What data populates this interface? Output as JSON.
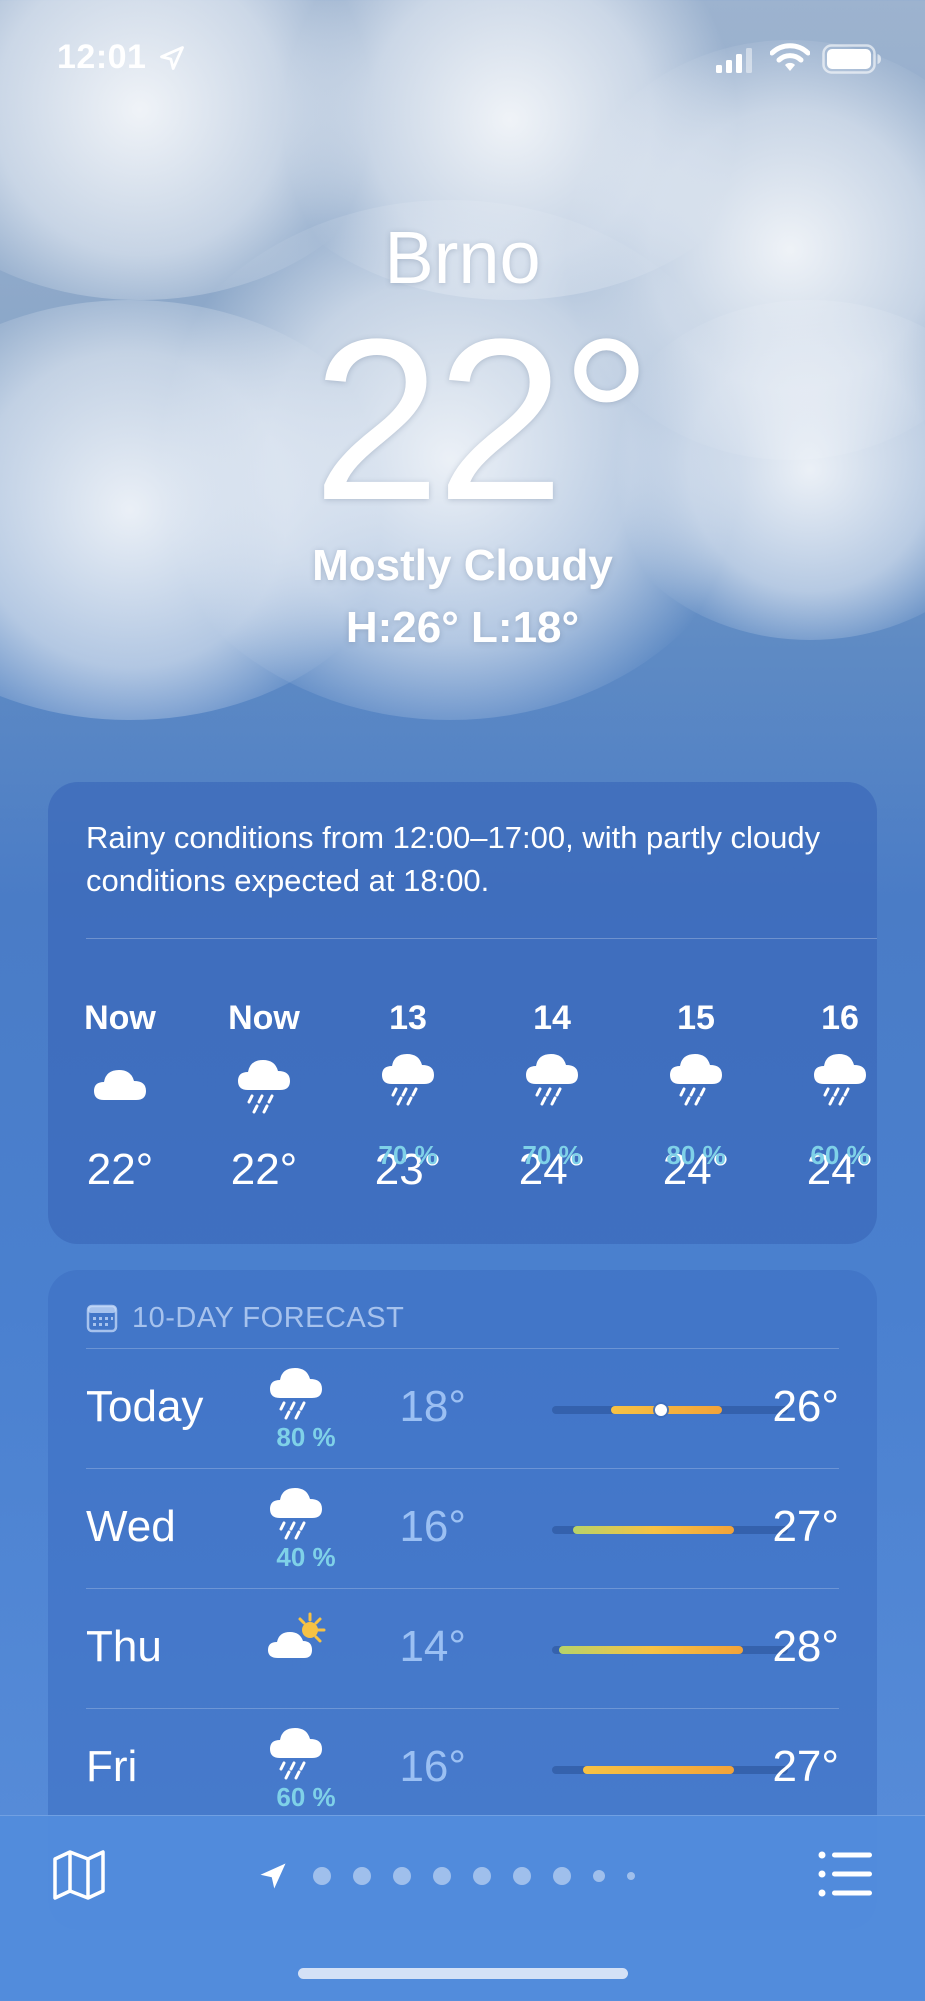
{
  "status_bar": {
    "time": "12:01"
  },
  "location": {
    "city": "Brno",
    "temperature": "22°",
    "condition": "Mostly Cloudy",
    "high_low": "H:26°  L:18°"
  },
  "hourly": {
    "summary": "Rainy conditions from 12:00–17:00, with partly cloudy conditions expected at 18:00.",
    "items": [
      {
        "label": "Now",
        "icon": "cloud-icon",
        "pop": "",
        "temp": "22°"
      },
      {
        "label": "Now",
        "icon": "cloud-rain-icon",
        "pop": "",
        "temp": "22°"
      },
      {
        "label": "13",
        "icon": "cloud-rain-icon",
        "pop": "70 %",
        "temp": "23°"
      },
      {
        "label": "14",
        "icon": "cloud-rain-icon",
        "pop": "70 %",
        "temp": "24°"
      },
      {
        "label": "15",
        "icon": "cloud-rain-icon",
        "pop": "80 %",
        "temp": "24°"
      },
      {
        "label": "16",
        "icon": "cloud-rain-icon",
        "pop": "60 %",
        "temp": "24°"
      }
    ]
  },
  "forecast": {
    "title": "10-DAY FORECAST",
    "days": [
      {
        "day": "Today",
        "icon": "cloud-rain-icon",
        "pop": "80 %",
        "low": "18°",
        "high": "26°",
        "bar_start": 0.25,
        "bar_end": 0.72,
        "current": 0.46
      },
      {
        "day": "Wed",
        "icon": "cloud-rain-icon",
        "pop": "40 %",
        "low": "16°",
        "high": "27°",
        "bar_start": 0.09,
        "bar_end": 0.77
      },
      {
        "day": "Thu",
        "icon": "partly-sunny-icon",
        "pop": "",
        "low": "14°",
        "high": "28°",
        "bar_start": 0.03,
        "bar_end": 0.81
      },
      {
        "day": "Fri",
        "icon": "cloud-rain-icon",
        "pop": "60 %",
        "low": "16°",
        "high": "27°",
        "bar_start": 0.13,
        "bar_end": 0.77
      }
    ]
  },
  "colors": {
    "temp_bar_cool": "#b7d36a",
    "temp_bar_warm": "#f7c244",
    "temp_bar_hot": "#f2a33a",
    "precip_text": "#7fd1e8"
  },
  "bottom_bar": {
    "page_count": 9
  }
}
